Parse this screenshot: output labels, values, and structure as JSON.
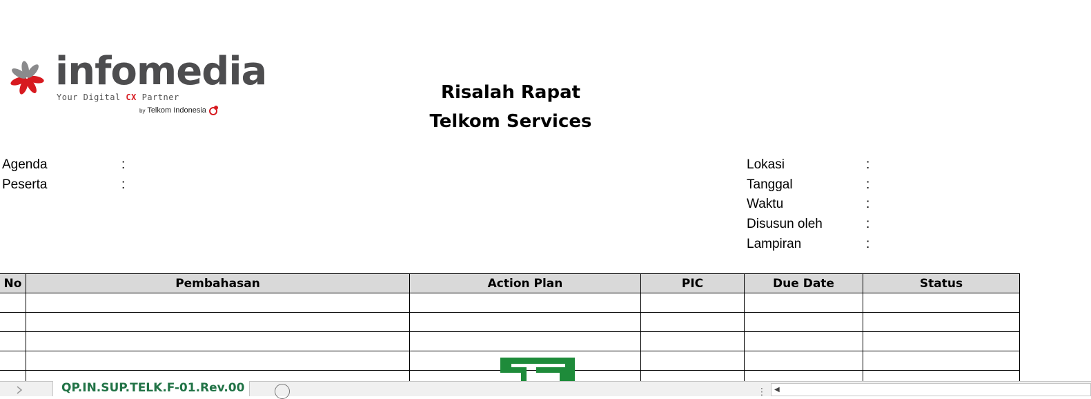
{
  "logo": {
    "wordmark": "infomedia",
    "tagline_before": "Your Digital ",
    "tagline_cx": "CX",
    "tagline_after": " Partner",
    "by_prefix": "by",
    "by_company": "Telkom Indonesia",
    "colors": {
      "red": "#d71a20",
      "grey": "#4d4d4f"
    }
  },
  "title": {
    "line1": "Risalah Rapat",
    "line2": "Telkom Services"
  },
  "left_fields": [
    {
      "label": "Agenda",
      "colon": ":"
    },
    {
      "label": "Peserta",
      "colon": ":"
    }
  ],
  "right_fields": [
    {
      "label": "Lokasi",
      "colon": ":"
    },
    {
      "label": "Tanggal",
      "colon": ":"
    },
    {
      "label": "Waktu",
      "colon": ":"
    },
    {
      "label": "Disusun oleh",
      "colon": ":"
    },
    {
      "label": "Lampiran",
      "colon": ":"
    }
  ],
  "table": {
    "headers": [
      "No",
      "Pembahasan",
      "Action Plan",
      "PIC",
      "Due Date",
      "Status"
    ],
    "empty_rows": 5,
    "header_bg": "#d9d9d9"
  },
  "sheet_tabs": {
    "active_tab": "QP.IN.SUP.TELK.F-01.Rev.00",
    "active_color": "#217346",
    "add_icon": "plus-circle-icon",
    "watermark_icon": "excel-watermark-icon"
  }
}
